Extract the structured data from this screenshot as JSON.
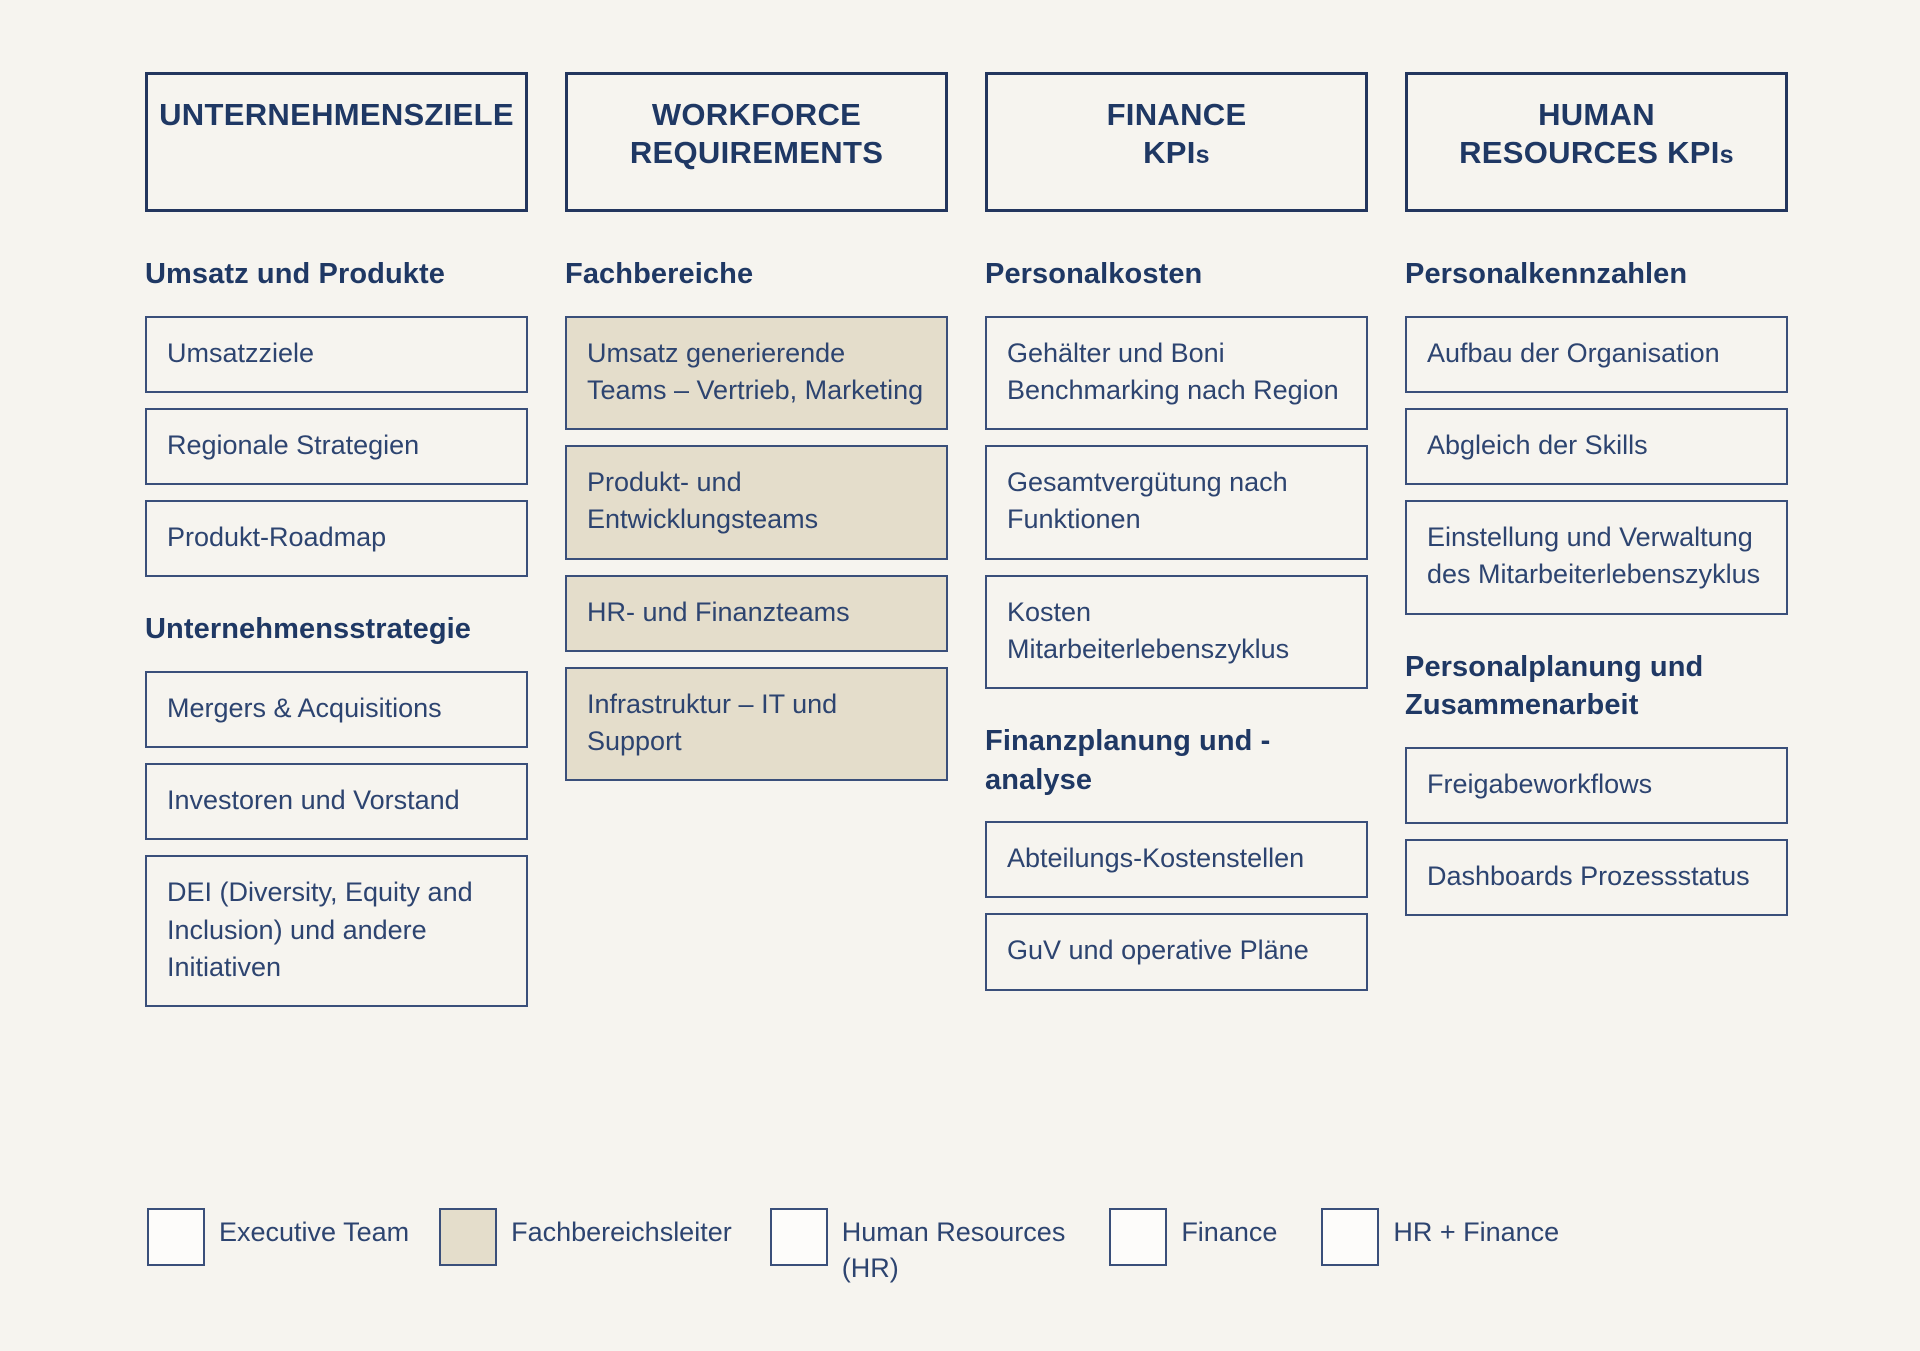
{
  "theme": {
    "background": "#f6f4ef",
    "ink": "#1f3864",
    "border": "#3a4f7a",
    "header_border": "#23365e",
    "fill_tan": "#e4ddcb",
    "fill_white": "#fdfcfa"
  },
  "columns": [
    {
      "header": "UNTERNEHMENSZIELE",
      "header_lines": [
        "UNTERNEHMENSZIELE"
      ],
      "sections": [
        {
          "heading": "Umsatz und Produkte",
          "items": [
            {
              "label": "Umsatzziele",
              "fill": "none"
            },
            {
              "label": "Regionale Strategien",
              "fill": "none"
            },
            {
              "label": "Produkt-Roadmap",
              "fill": "none"
            }
          ]
        },
        {
          "heading": "Unternehmensstrategie",
          "items": [
            {
              "label": "Mergers & Acquisitions",
              "fill": "none"
            },
            {
              "label": "Investoren und Vorstand",
              "fill": "none"
            },
            {
              "label": "DEI (Diversity, Equity and Inclusion) und andere Initiativen",
              "fill": "none"
            }
          ]
        }
      ]
    },
    {
      "header": "WORKFORCE REQUIREMENTS",
      "header_lines": [
        "WORKFORCE",
        "REQUIREMENTS"
      ],
      "sections": [
        {
          "heading": "Fachbereiche",
          "items": [
            {
              "label": "Umsatz generierende Teams – Vertrieb, Marketing",
              "fill": "tan"
            },
            {
              "label": "Produkt- und Entwicklungsteams",
              "fill": "tan"
            },
            {
              "label": "HR- und Finanzteams",
              "fill": "tan"
            },
            {
              "label": "Infrastruktur – IT und Support",
              "fill": "tan"
            }
          ]
        }
      ]
    },
    {
      "header": "FINANCE KPIs",
      "header_lines": [
        "FINANCE",
        "KPIs"
      ],
      "sections": [
        {
          "heading": "Personalkosten",
          "items": [
            {
              "label": "Gehälter und Boni Benchmarking nach Region",
              "fill": "none"
            },
            {
              "label": "Gesamtvergütung nach Funktionen",
              "fill": "none"
            },
            {
              "label": "Kosten Mitarbeiterlebenszyklus",
              "fill": "none"
            }
          ]
        },
        {
          "heading": "Finanzplanung und -analyse",
          "items": [
            {
              "label": "Abteilungs-Kostenstellen",
              "fill": "none"
            },
            {
              "label": "GuV und operative Pläne",
              "fill": "none"
            }
          ]
        }
      ]
    },
    {
      "header": "HUMAN RESOURCES KPIs",
      "header_lines": [
        "HUMAN",
        "RESOURCES KPIs"
      ],
      "sections": [
        {
          "heading": "Personalkennzahlen",
          "items": [
            {
              "label": "Aufbau der Organisation",
              "fill": "none"
            },
            {
              "label": "Abgleich der Skills",
              "fill": "none"
            },
            {
              "label": "Einstellung und Verwaltung des Mitarbeiterlebenszyklus",
              "fill": "none"
            }
          ]
        },
        {
          "heading": "Personalplanung und Zusammenarbeit",
          "items": [
            {
              "label": "Freigabeworkflows",
              "fill": "none"
            },
            {
              "label": "Dashboards Prozessstatus",
              "fill": "none"
            }
          ]
        }
      ]
    }
  ],
  "legend": [
    {
      "label": "Executive Team",
      "fill": "none"
    },
    {
      "label": "Fachbereichsleiter",
      "fill": "tan"
    },
    {
      "label": "Human Resources\n(HR)",
      "fill": "none"
    },
    {
      "label": "Finance",
      "fill": "none"
    },
    {
      "label": "HR + Finance",
      "fill": "none"
    }
  ]
}
